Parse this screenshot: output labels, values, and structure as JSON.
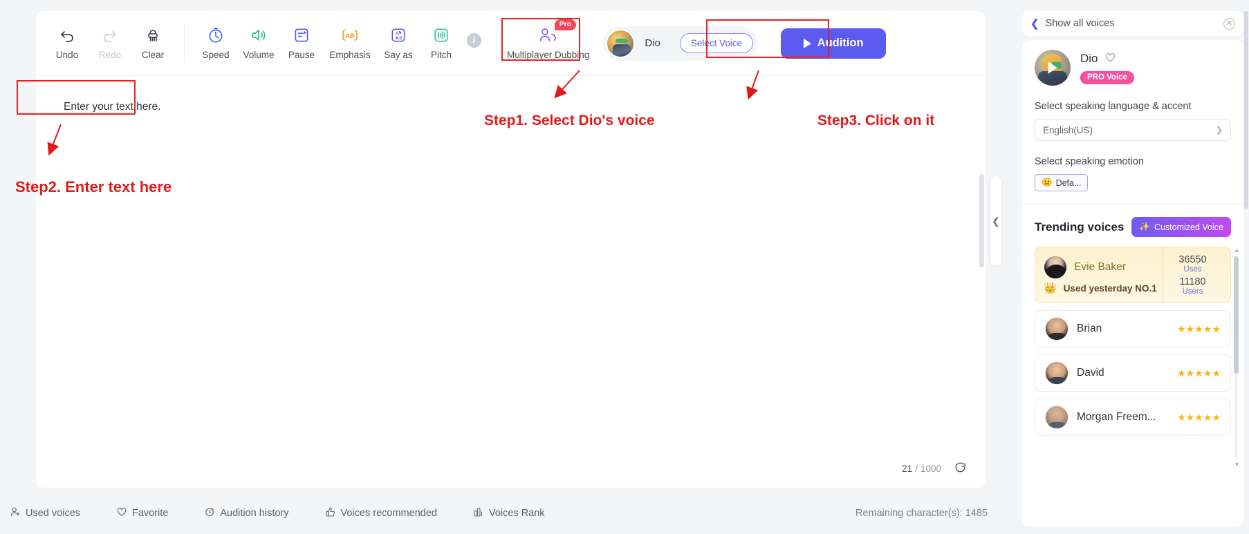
{
  "toolbar": {
    "history": [
      {
        "label": "Undo",
        "icon": "undo-icon",
        "disabled": false
      },
      {
        "label": "Redo",
        "icon": "redo-icon",
        "disabled": true
      },
      {
        "label": "Clear",
        "icon": "clear-icon",
        "disabled": false
      }
    ],
    "effects": [
      {
        "label": "Speed",
        "icon": "speed-icon"
      },
      {
        "label": "Volume",
        "icon": "volume-icon"
      },
      {
        "label": "Pause",
        "icon": "pause-icon"
      },
      {
        "label": "Emphasis",
        "icon": "emphasis-icon"
      },
      {
        "label": "Say as",
        "icon": "say-as-icon"
      },
      {
        "label": "Pitch",
        "icon": "pitch-icon"
      }
    ],
    "info_icon": "info-icon",
    "multiplayer": {
      "label": "Multiplayer Dubbing",
      "badge": "Pro",
      "icon": "multiplayer-dubbing-icon"
    },
    "voice_name": "Dio",
    "select_voice_label": "Select Voice",
    "audition_label": "Audition"
  },
  "editor": {
    "placeholder": "Enter your text here.",
    "char_current": "21",
    "char_separator": "/",
    "char_max": "1000",
    "refresh_icon": "refresh-icon"
  },
  "annotations": {
    "step1": "Step1. Select Dio's voice",
    "step2": "Step2. Enter text here",
    "step3": "Step3. Click on it",
    "color": "#e2191a"
  },
  "statusbar": {
    "links": [
      {
        "label": "Used voices",
        "icon": "used-voices-icon"
      },
      {
        "label": "Favorite",
        "icon": "heart-icon"
      },
      {
        "label": "Audition history",
        "icon": "history-clock-icon"
      },
      {
        "label": "Voices recommended",
        "icon": "thumbs-up-icon"
      },
      {
        "label": "Voices Rank",
        "icon": "bar-chart-icon"
      }
    ],
    "remaining": "Remaining character(s): 1485"
  },
  "sidebar": {
    "back_label": "Show all voices",
    "close_icon": "close-icon",
    "voice": {
      "name": "Dio",
      "favorite_icon": "heart-icon",
      "badge": "PRO Voice",
      "play_icon": "play-icon"
    },
    "language_label": "Select speaking language & accent",
    "language_value": "English(US)",
    "emotion_label": "Select speaking emotion",
    "emotion_chip": {
      "emoji": "😐",
      "label": "Defa..."
    },
    "trending_title": "Trending voices",
    "customized_voice_label": "Customized Voice",
    "customized_voice_icon": "sparkle-icon",
    "featured": {
      "name": "Evie Baker",
      "subtitle": "Used yesterday NO.1",
      "crown_icon": "crown-icon",
      "uses_num": "36550",
      "uses_label": "Uses",
      "users_num": "11180",
      "users_label": "Users"
    },
    "voices": [
      {
        "name": "Brian",
        "stars": "★★★★★",
        "avatar": "brian"
      },
      {
        "name": "David",
        "stars": "★★★★★",
        "avatar": "david"
      },
      {
        "name": "Morgan Freem...",
        "stars": "★★★★★",
        "avatar": "morgan"
      }
    ]
  },
  "colors": {
    "accent": "#5b5bf0",
    "annotation": "#e2191a",
    "pro_badge": "#f5455c",
    "pro_voice": "#f34fa0",
    "star": "#f9b219"
  }
}
